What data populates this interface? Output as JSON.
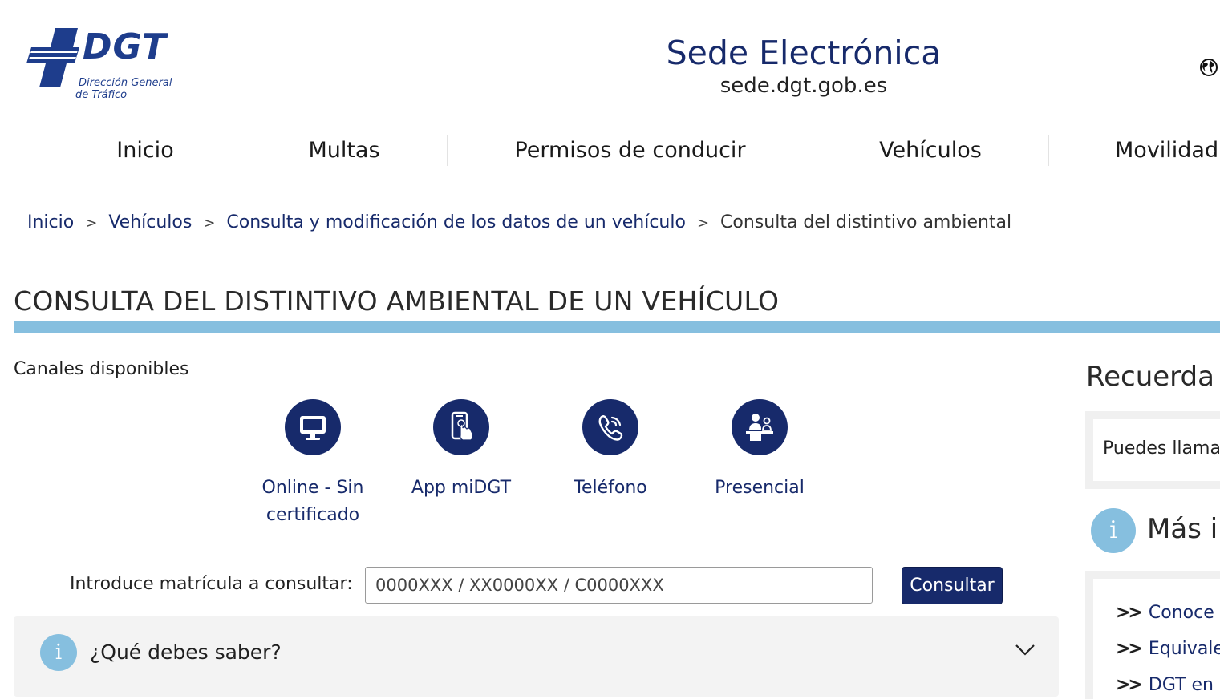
{
  "header": {
    "logo": {
      "word": "DGT",
      "sub1": "Dirección General",
      "sub2": "de Tráfico"
    },
    "site_title": "Sede Electrónica",
    "site_url": "sede.dgt.gob.es",
    "language_icon": "globe-icon"
  },
  "nav": {
    "items": [
      {
        "label": "Inicio"
      },
      {
        "label": "Multas"
      },
      {
        "label": "Permisos de conducir"
      },
      {
        "label": "Vehículos"
      },
      {
        "label": "Movilidad"
      }
    ]
  },
  "breadcrumb": {
    "items": [
      "Inicio",
      "Vehículos",
      "Consulta y modificación de los datos de un vehículo"
    ],
    "current": "Consulta del distintivo ambiental",
    "separator": ">"
  },
  "page": {
    "title": "CONSULTA DEL DISTINTIVO AMBIENTAL DE UN VEHÍCULO",
    "accent_color": "#86bfdf",
    "primary_color": "#172a6b"
  },
  "channels": {
    "label": "Canales disponibles",
    "items": [
      {
        "icon": "monitor-icon",
        "line1": "Online - Sin",
        "line2": "certificado"
      },
      {
        "icon": "mobile-touch-icon",
        "line1": "App miDGT",
        "line2": ""
      },
      {
        "icon": "phone-icon",
        "line1": "Teléfono",
        "line2": ""
      },
      {
        "icon": "in-person-desk-icon",
        "line1": "Presencial",
        "line2": ""
      }
    ]
  },
  "form": {
    "label": "Introduce matrícula a consultar:",
    "placeholder": "0000XXX / XX0000XX / C0000XXX",
    "button": "Consultar"
  },
  "accordion": {
    "title": "¿Qué debes saber?",
    "icon": "info-icon"
  },
  "sidebar": {
    "recuerda_title": "Recuerda",
    "recuerda_text": "Puedes llamar",
    "mas_title": "Más i",
    "links": [
      "Conoce l",
      "Equivalen",
      "DGT en C"
    ]
  }
}
